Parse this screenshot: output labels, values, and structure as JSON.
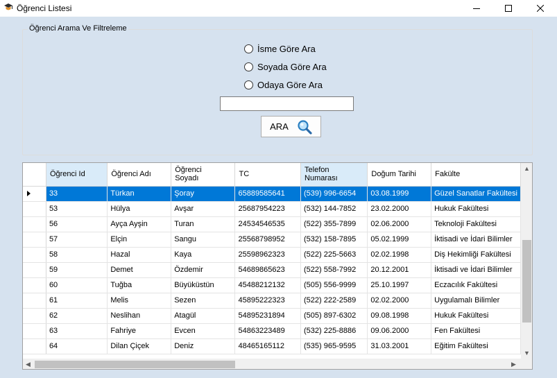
{
  "window": {
    "title": "Öğrenci Listesi"
  },
  "filter_group": {
    "title": "Öğrenci Arama Ve Filtreleme",
    "radios": [
      {
        "label": "İsme Göre Ara",
        "checked": false
      },
      {
        "label": "Soyada Göre Ara",
        "checked": false
      },
      {
        "label": "Odaya Göre Ara",
        "checked": false
      }
    ],
    "search_value": "",
    "search_button_label": "ARA",
    "search_button_icon": "magnifier-icon"
  },
  "grid": {
    "columns": [
      "Öğrenci Id",
      "Öğrenci Adı",
      "Öğrenci\nSoyadı",
      "TC",
      "Telefon\nNumarası",
      "Doğum Tarihi",
      "Fakülte"
    ],
    "selected_row": 0,
    "rows": [
      [
        "33",
        "Türkan",
        "Şoray",
        "65889585641",
        "(539) 996-6654",
        "03.08.1999",
        "Güzel Sanatlar Fakültesi"
      ],
      [
        "53",
        "Hülya",
        "Avşar",
        "25687954223",
        "(532) 144-7852",
        "23.02.2000",
        "Hukuk Fakültesi"
      ],
      [
        "56",
        "Ayça Ayşin",
        "Turan",
        "24534546535",
        "(522) 355-7899",
        "02.06.2000",
        "Teknoloji Fakültesi"
      ],
      [
        "57",
        "Elçin",
        "Sangu",
        "25568798952",
        "(532) 158-7895",
        "05.02.1999",
        "İktisadi ve İdari Bilimler"
      ],
      [
        "58",
        "Hazal",
        "Kaya",
        "25598962323",
        "(522) 225-5663",
        "02.02.1998",
        "Diş Hekimliği Fakültesi"
      ],
      [
        "59",
        "Demet",
        "Özdemir",
        "54689865623",
        "(522) 558-7992",
        "20.12.2001",
        "İktisadi ve İdari Bilimler"
      ],
      [
        "60",
        "Tuğba",
        "Büyüküstün",
        "45488212132",
        "(505) 556-9999",
        "25.10.1997",
        "Eczacılık Fakültesi"
      ],
      [
        "61",
        "Melis",
        "Sezen",
        "45895222323",
        "(522) 222-2589",
        "02.02.2000",
        "Uygulamalı Bilimler"
      ],
      [
        "62",
        "Neslihan",
        "Atagül",
        "54895231894",
        "(505) 897-6302",
        "09.08.1998",
        "Hukuk Fakültesi"
      ],
      [
        "63",
        "Fahriye",
        "Evcen",
        "54863223489",
        "(532) 225-8886",
        "09.06.2000",
        "Fen Fakültesi"
      ],
      [
        "64",
        "Dilan Çiçek",
        "Deniz",
        "48465165112",
        "(535) 965-9595",
        "31.03.2001",
        "Eğitim Fakültesi"
      ]
    ]
  },
  "colors": {
    "client_bg": "#d6e2ef",
    "selection": "#0078d7",
    "header_selected": "#d9ebf9"
  }
}
